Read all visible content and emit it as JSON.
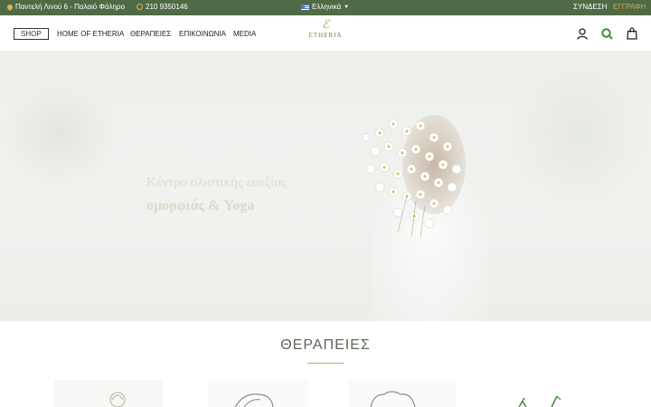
{
  "topbar": {
    "address": "Παντελή Λινού 6 - Παλαιό Φάληρο",
    "phone": "210 9350146",
    "language": "Ελληνικά",
    "login": "ΣΥΝΔΕΣΗ",
    "register": "ΕΓΓΡΑΦΗ"
  },
  "nav": {
    "shop": "SHOP",
    "items": [
      {
        "label": "HOME OF ETHERIA"
      },
      {
        "label": "ΘΕΡΑΠΕΙΕΣ"
      },
      {
        "label": "ΕΠΙΚΟΙΝΩΝΙΑ"
      },
      {
        "label": "MEDIA"
      }
    ],
    "logo_text": "ETHERIA",
    "icons": [
      "user-icon",
      "search-icon",
      "shopping-bag-icon"
    ]
  },
  "hero": {
    "title": "Κέντρο ολιστικής ευεξίας",
    "subtitle": "ομορφιάς & Yoga"
  },
  "therapies": {
    "title": "ΘΕΡΑΠΕΙΕΣ"
  },
  "colors": {
    "topbar_bg": "#4f6a45",
    "accent_gold": "#c9a85c",
    "search_green": "#3e8a3a"
  }
}
